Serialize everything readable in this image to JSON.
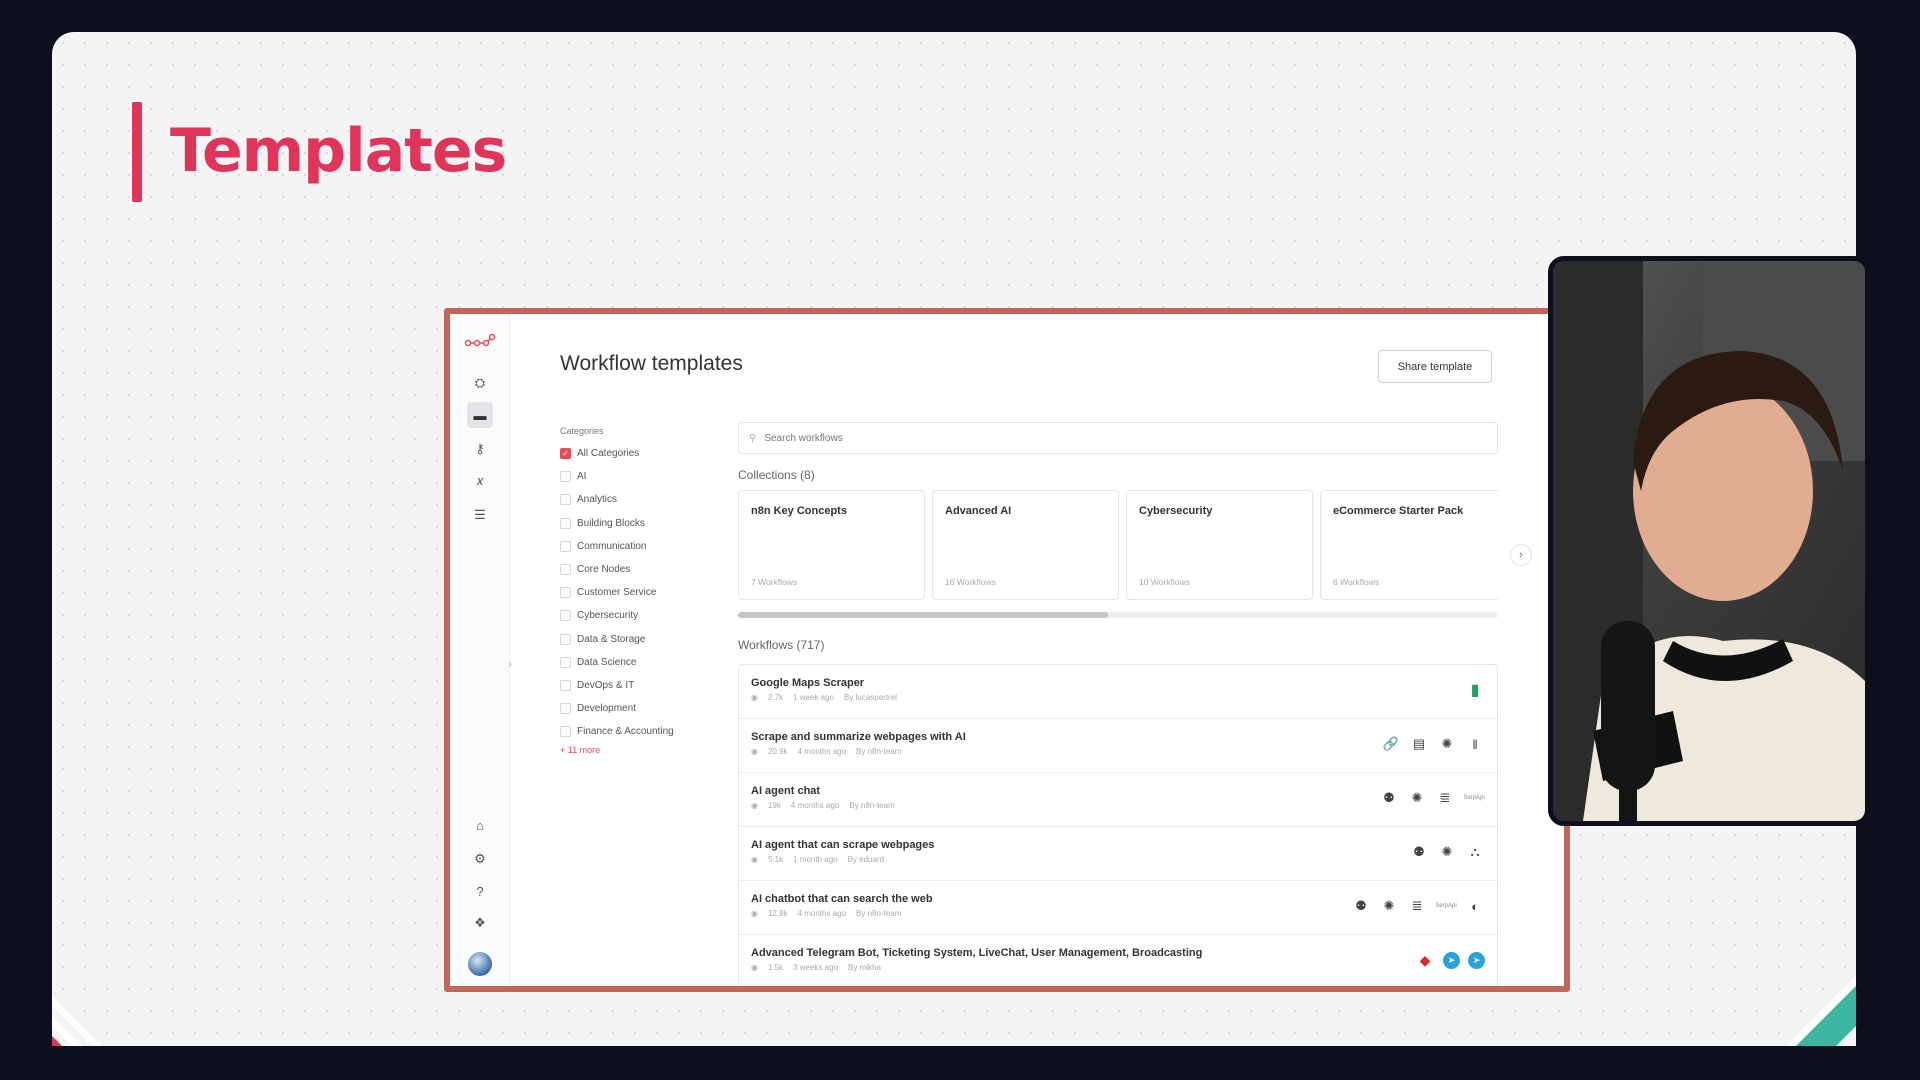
{
  "slide": {
    "title": "Templates"
  },
  "app": {
    "page_heading": "Workflow templates",
    "share_label": "Share template",
    "search_placeholder": "Search workflows",
    "categories_label": "Categories",
    "categories": [
      {
        "label": "All Categories",
        "checked": true
      },
      {
        "label": "AI",
        "checked": false
      },
      {
        "label": "Analytics",
        "checked": false
      },
      {
        "label": "Building Blocks",
        "checked": false
      },
      {
        "label": "Communication",
        "checked": false
      },
      {
        "label": "Core Nodes",
        "checked": false
      },
      {
        "label": "Customer Service",
        "checked": false
      },
      {
        "label": "Cybersecurity",
        "checked": false
      },
      {
        "label": "Data & Storage",
        "checked": false
      },
      {
        "label": "Data Science",
        "checked": false
      },
      {
        "label": "DevOps & IT",
        "checked": false
      },
      {
        "label": "Development",
        "checked": false
      },
      {
        "label": "Finance & Accounting",
        "checked": false
      }
    ],
    "more_categories": "+ 11 more",
    "collections_title": "Collections (8)",
    "collections": [
      {
        "name": "n8n Key Concepts",
        "count": "7 Workflows"
      },
      {
        "name": "Advanced AI",
        "count": "16 Workflows"
      },
      {
        "name": "Cybersecurity",
        "count": "10 Workflows"
      },
      {
        "name": "eCommerce Starter Pack",
        "count": "6 Workflows"
      }
    ],
    "workflows_title": "Workflows (717)",
    "workflows": [
      {
        "name": "Google Maps Scraper",
        "views": "2.7k",
        "age": "1 week ago",
        "author": "By lucaspertrel",
        "icons": [
          "sheets-icon"
        ]
      },
      {
        "name": "Scrape and summarize webpages with AI",
        "views": "20.9k",
        "age": "4 months ago",
        "author": "By n8n-team",
        "icons": [
          "link-icon",
          "document-icon",
          "openai-icon",
          "bars-icon"
        ]
      },
      {
        "name": "AI agent chat",
        "views": "19k",
        "age": "4 months ago",
        "author": "By n8n-team",
        "icons": [
          "robot-icon",
          "openai-icon",
          "database-icon",
          "serpapi-icon"
        ]
      },
      {
        "name": "AI agent that can scrape webpages",
        "views": "5.1k",
        "age": "1 month ago",
        "author": "By eduard",
        "icons": [
          "robot-icon",
          "openai-icon",
          "workflow-icon"
        ]
      },
      {
        "name": "AI chatbot that can search the web",
        "views": "12.9k",
        "age": "4 months ago",
        "author": "By n8n-team",
        "icons": [
          "robot-icon",
          "openai-icon",
          "database-icon",
          "serpapi-icon",
          "globe-icon"
        ]
      },
      {
        "name": "Advanced Telegram Bot, Ticketing System, LiveChat, User Management, Broadcasting",
        "views": "1.5k",
        "age": "3 weeks ago",
        "author": "By mikha",
        "icons": [
          "redbox-icon",
          "telegram-icon",
          "telegram-icon"
        ]
      }
    ]
  },
  "colors": {
    "accent": "#e0345a",
    "frame_border": "#c0675a",
    "checkbox": "#e24d5a"
  }
}
